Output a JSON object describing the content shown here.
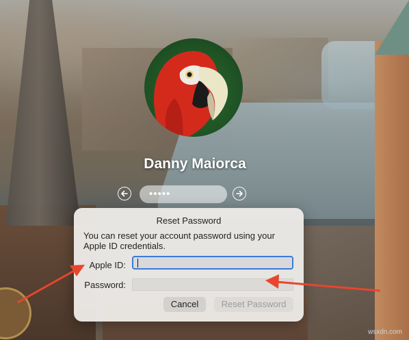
{
  "login": {
    "user_name": "Danny Maiorca",
    "password_mask": "•••••"
  },
  "reset_dialog": {
    "title": "Reset Password",
    "description": "You can reset your account password using your Apple ID credentials.",
    "apple_id_label": "Apple ID:",
    "apple_id_value": "",
    "password_label": "Password:",
    "password_value": "",
    "cancel_label": "Cancel",
    "reset_label": "Reset Password"
  },
  "icons": [
    "back-arrow-icon",
    "forward-arrow-icon",
    "parrot-avatar"
  ],
  "colors": {
    "annotation_arrow": "#e8452f",
    "focus_ring": "#3b7bd8"
  },
  "watermark": "wsxdn.com"
}
